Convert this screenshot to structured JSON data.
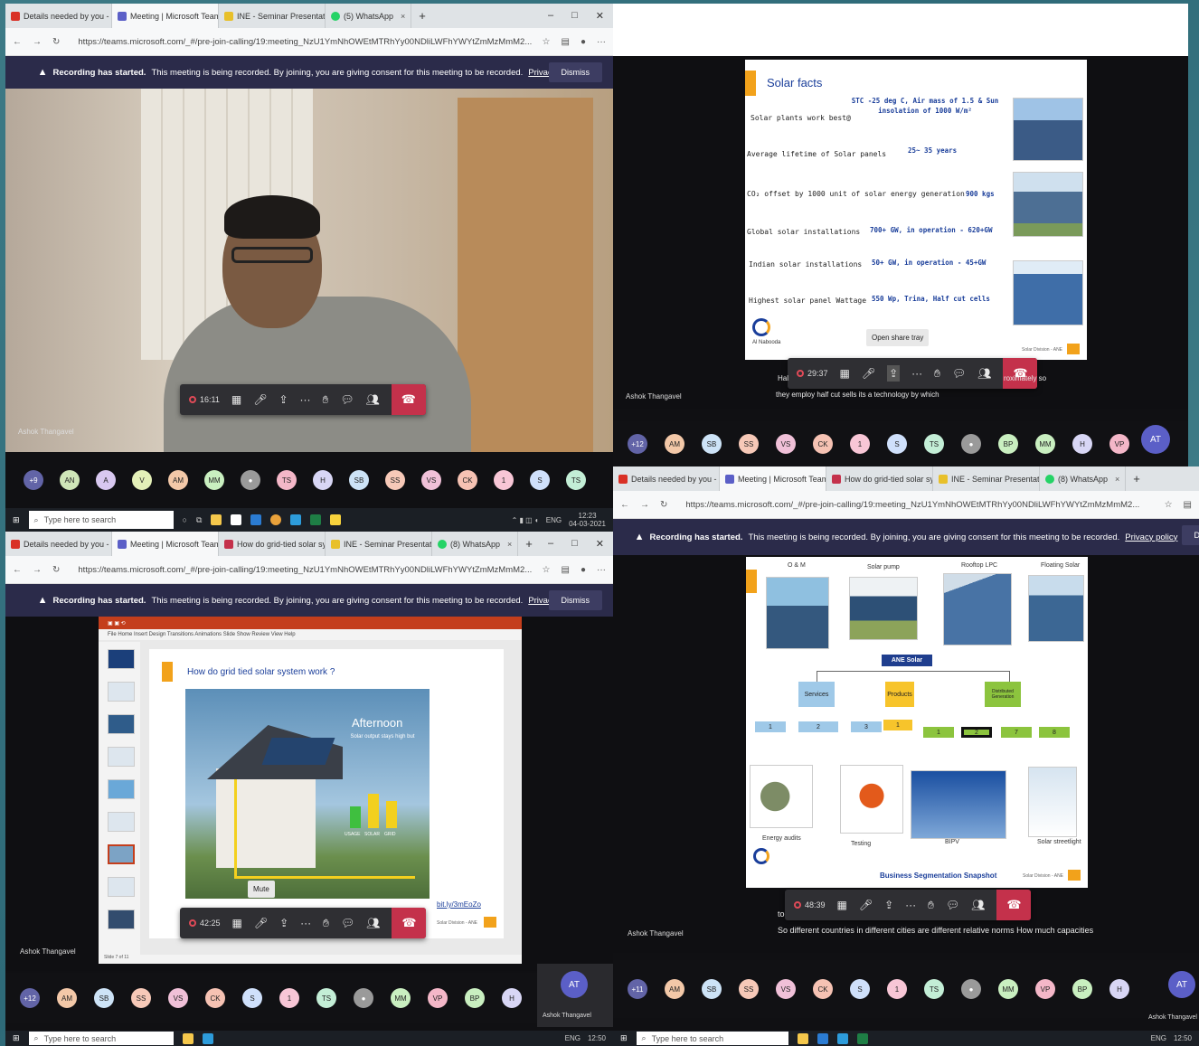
{
  "browser": {
    "tabs_a": [
      "Details needed by you - s.sundi",
      "Meeting | Microsoft Teams",
      "INE - Seminar Presentation",
      "(5) WhatsApp"
    ],
    "tabs_b": [
      "Details needed by you - s.sundi",
      "Meeting | Microsoft Team",
      "How do grid-tied solar system",
      "INE - Seminar Presentation",
      "(8) WhatsApp"
    ],
    "url": "https://teams.microsoft.com/_#/pre-join-calling/19:meeting_NzU1YmNhOWEtMTRhYy00NDliLWFhYWYtZmMzMmM2..."
  },
  "recording": {
    "bold": "Recording has started.",
    "text": "This meeting is being recorded. By joining, you are giving consent for this meeting to be recorded.",
    "link": "Privacy policy",
    "dismiss": "Dismiss"
  },
  "speaker_name": "Ashok Thangavel",
  "timers": {
    "tl": "16:11",
    "tr": "29:37",
    "bl": "42:25",
    "br": "48:39"
  },
  "tooltips": {
    "tr": "Open share tray",
    "bl": "Mute"
  },
  "captions": {
    "tr1": "Hal",
    "tr2": "they employ half cut sells its a technology by which",
    "tr3": "roximately so",
    "br1": "to",
    "br2": "So different countries in different cities are different relative norms How much capacities"
  },
  "avatars_tl": [
    "+9",
    "AN",
    "A",
    "V",
    "AM",
    "MM",
    "",
    "TS",
    "H",
    "SB",
    "SS",
    "VS",
    "CK",
    "1",
    "S",
    "TS"
  ],
  "avatars_tr": [
    "+12",
    "AM",
    "SB",
    "SS",
    "VS",
    "CK",
    "1",
    "S",
    "TS",
    "",
    "BP",
    "MM",
    "H",
    "VP"
  ],
  "avatars_bl": [
    "+12",
    "AM",
    "SB",
    "SS",
    "VS",
    "CK",
    "S",
    "1",
    "TS",
    "",
    "MM",
    "VP",
    "BP",
    "H"
  ],
  "avatars_br": [
    "+11",
    "AM",
    "SB",
    "SS",
    "VS",
    "CK",
    "S",
    "1",
    "TS",
    "",
    "MM",
    "VP",
    "BP",
    "H"
  ],
  "self_avatar": "AT",
  "self_name": "Ashok Thangavel",
  "taskbar": {
    "search": "Type here to search",
    "lang": "ENG",
    "time_tl": "12:23",
    "date_tl": "04-03-2021",
    "time_b": "12:50"
  },
  "solar_facts": {
    "title": "Solar facts",
    "rows": [
      {
        "label": "Solar plants work best@",
        "value": "STC -25 deg C, Air mass of 1.5 & Sun insolation of 1000 W/m²"
      },
      {
        "label": "Average lifetime of Solar panels",
        "value": "25~ 35 years"
      },
      {
        "label": "CO₂ offset by 1000 unit of solar energy generation",
        "value": "900 kgs"
      },
      {
        "label": "Global solar installations",
        "value": "700+ GW, in operation - 620+GW"
      },
      {
        "label": "Indian solar installations",
        "value": "50+ GW, in operation - 45+GW"
      },
      {
        "label": "Highest solar panel Wattage",
        "value": "550 Wp, Trina, Half cut cells"
      }
    ],
    "logo": "Al Nabooda",
    "footer": "Solar Division - ANE"
  },
  "grid_slide": {
    "title": "How do grid tied solar system work ?",
    "afternoon": "Afternoon",
    "afternoon_sub": "Solar output stays high but",
    "bars": [
      "USAGE",
      "SOLAR",
      "GRID"
    ],
    "link": "bit.ly/3mEoZo",
    "footer": "Solar Division - ANE",
    "status": "Slide 7 of 11"
  },
  "segment_slide": {
    "top_labels": [
      "O & M",
      "Solar pump",
      "Rooftop LPC",
      "Floating Solar"
    ],
    "root": "ANE Solar",
    "branches": [
      "Services",
      "Products",
      "Distributed Generation"
    ],
    "bottom_labels": [
      "Energy audits",
      "Testing",
      "BIPV",
      "Solar streetlight"
    ],
    "caption": "Business Segmentation Snapshot",
    "footer": "Solar Division - ANE"
  }
}
